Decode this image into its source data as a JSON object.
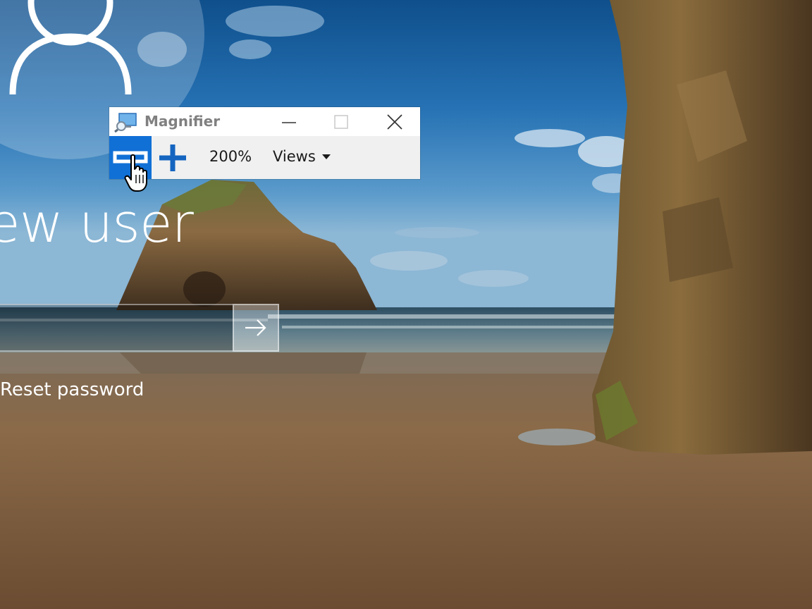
{
  "lock_screen": {
    "user_name": "ew user",
    "password_placeholder": "",
    "submit_icon": "arrow-right-icon",
    "reset_password_label": "Reset password",
    "avatar_icon": "user-icon"
  },
  "magnifier": {
    "title": "Magnifier",
    "app_icon": "magnifier-icon",
    "zoom_out_icon": "minus-icon",
    "zoom_in_icon": "plus-icon",
    "zoom_level": "200%",
    "views_label": "Views",
    "window_buttons": [
      "minimize-icon",
      "maximize-icon",
      "close-icon"
    ]
  },
  "colors": {
    "accent": "#1170d6",
    "zoom_icon_blue": "#1565c0",
    "title_gray": "#808080"
  }
}
